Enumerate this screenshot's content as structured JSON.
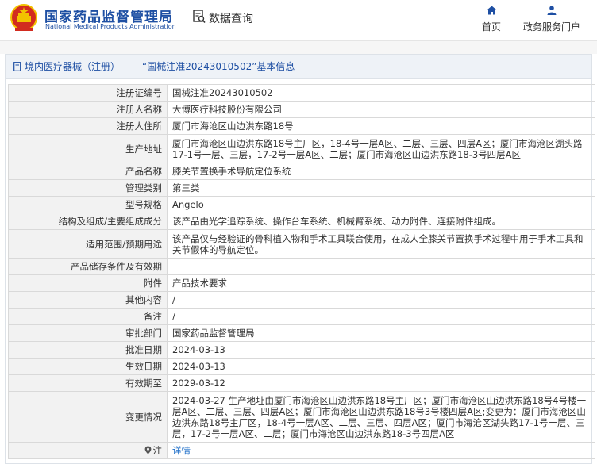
{
  "header": {
    "brand_cn": "国家药品监督管理局",
    "brand_en": "National Medical Products Administration",
    "section_title": "数据查询",
    "nav": [
      {
        "label": "首页",
        "icon": "home-icon"
      },
      {
        "label": "政务服务门户",
        "icon": "user-icon"
      }
    ]
  },
  "breadcrumb": {
    "category": "境内医疗器械（注册）",
    "separator": "——",
    "record": "“国械注准20243010502”基本信息"
  },
  "rows": [
    {
      "label": "注册证编号",
      "value": "国械注准20243010502"
    },
    {
      "label": "注册人名称",
      "value": "大博医疗科技股份有限公司"
    },
    {
      "label": "注册人住所",
      "value": "厦门市海沧区山边洪东路18号"
    },
    {
      "label": "生产地址",
      "value": "厦门市海沧区山边洪东路18号主厂区，18-4号一层A区、二层、三层、四层A区；厦门市海沧区湖头路17-1号一层、三层，17-2号一层A区、二层；厦门市海沧区山边洪东路18-3号四层A区"
    },
    {
      "label": "产品名称",
      "value": "膝关节置换手术导航定位系统"
    },
    {
      "label": "管理类别",
      "value": "第三类"
    },
    {
      "label": "型号规格",
      "value": "Angelo"
    },
    {
      "label": "结构及组成/主要组成成分",
      "value": "该产品由光学追踪系统、操作台车系统、机械臂系统、动力附件、连接附件组成。"
    },
    {
      "label": "适用范围/预期用途",
      "value": "该产品仅与经验证的骨科植入物和手术工具联合使用，在成人全膝关节置换手术过程中用于手术工具和关节假体的导航定位。"
    },
    {
      "label": "产品储存条件及有效期",
      "value": ""
    },
    {
      "label": "附件",
      "value": "产品技术要求"
    },
    {
      "label": "其他内容",
      "value": "/"
    },
    {
      "label": "备注",
      "value": "/"
    },
    {
      "label": "审批部门",
      "value": "国家药品监督管理局"
    },
    {
      "label": "批准日期",
      "value": "2024-03-13"
    },
    {
      "label": "生效日期",
      "value": "2024-03-13"
    },
    {
      "label": "有效期至",
      "value": "2029-03-12"
    },
    {
      "label": "变更情况",
      "value": "2024-03-27 生产地址由厦门市海沧区山边洪东路18号主厂区；厦门市海沧区山边洪东路18号4号楼一层A区、二层、三层、四层A区；厦门市海沧区山边洪东路18号3号楼四层A区;变更为：厦门市海沧区山边洪东路18号主厂区，18-4号一层A区、二层、三层、四层A区；厦门市海沧区湖头路17-1号一层、三层，17-2号一层A区、二层；厦门市海沧区山边洪东路18-3号四层A区"
    },
    {
      "label": "注",
      "value": "详情"
    }
  ],
  "colors": {
    "brand": "#1e4fa3",
    "link": "#1e6ec8",
    "emblem_red": "#d22b1f",
    "emblem_gold": "#f2c200"
  }
}
